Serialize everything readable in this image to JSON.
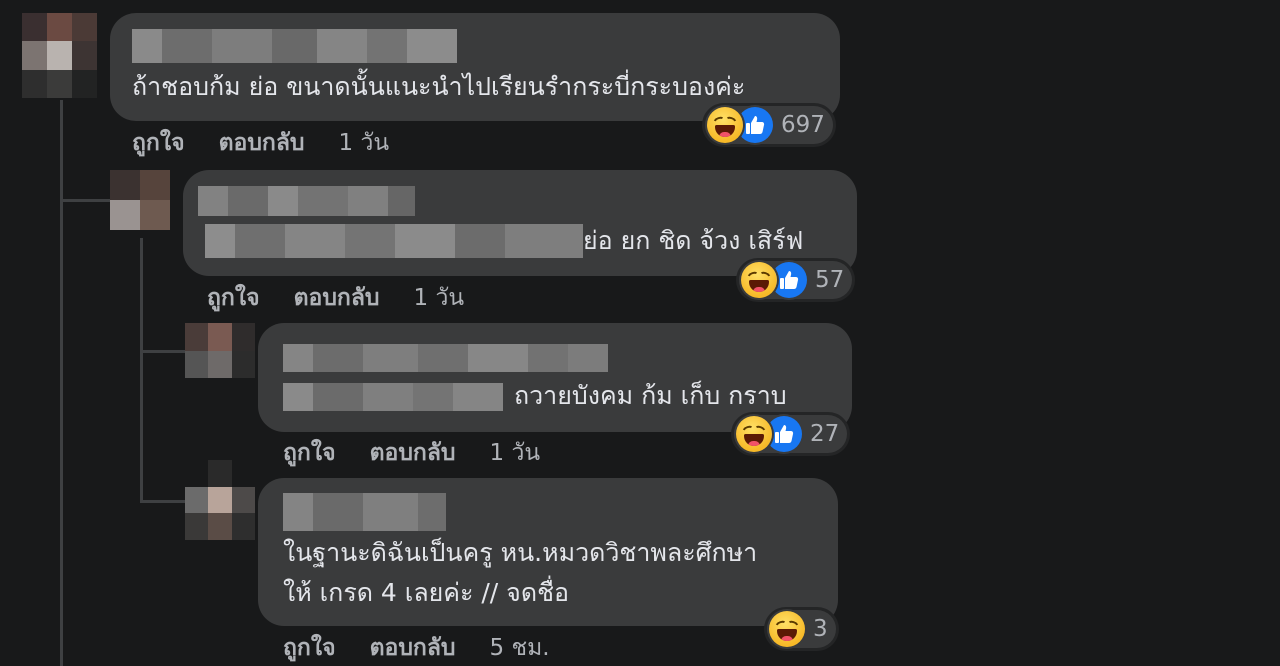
{
  "colors": {
    "background": "#18191a",
    "bubble": "#3a3b3c",
    "secondary_text": "#b0b3b8",
    "like_blue": "#1877f2",
    "haha_yellow": "#f7b928"
  },
  "comments": [
    {
      "text": "ถ้าชอบก้ม ย่อ ขนาดนั้นแนะนำไปเรียนรำกระบี่กระบองค่ะ",
      "reactions": {
        "icons": [
          "haha-icon",
          "like-icon"
        ],
        "count": "697"
      },
      "actions": {
        "like": "ถูกใจ",
        "reply": "ตอบกลับ",
        "time": "1 วัน"
      }
    },
    {
      "text": "ย่อ ยก ชิด จ้วง เสิร์ฟ",
      "reactions": {
        "icons": [
          "haha-icon",
          "like-icon"
        ],
        "count": "57"
      },
      "actions": {
        "like": "ถูกใจ",
        "reply": "ตอบกลับ",
        "time": "1 วัน"
      }
    },
    {
      "text": "ถวายบังคม ก้ม เก็บ กราบ",
      "reactions": {
        "icons": [
          "haha-icon",
          "like-icon"
        ],
        "count": "27"
      },
      "actions": {
        "like": "ถูกใจ",
        "reply": "ตอบกลับ",
        "time": "1 วัน"
      }
    },
    {
      "text_line1": "ในฐานะดิฉันเป็นครู หน.หมวดวิชาพละศึกษา",
      "text_line2": "ให้ เกรด 4 เลยค่ะ // จดชื่อ",
      "reactions": {
        "icons": [
          "haha-icon"
        ],
        "count": "3"
      },
      "actions": {
        "like": "ถูกใจ",
        "reply": "ตอบกลับ",
        "time": "5 ชม."
      }
    }
  ]
}
